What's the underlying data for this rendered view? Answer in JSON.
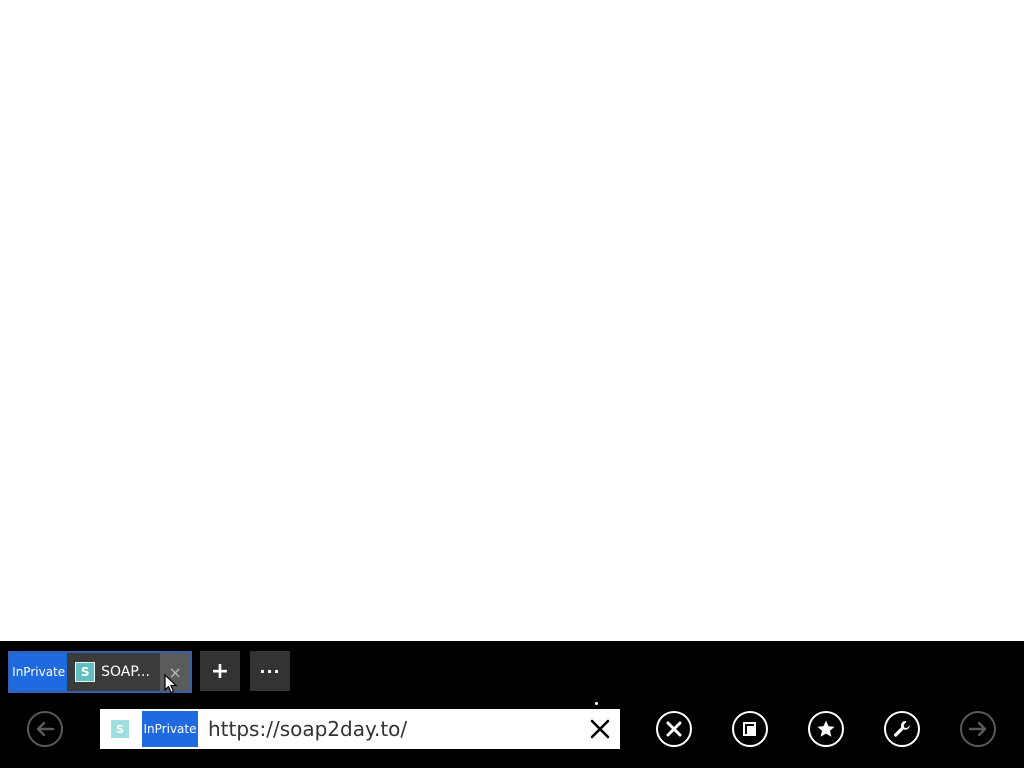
{
  "tab_strip": {
    "tabs": [
      {
        "inprivate_label": "InPrivate",
        "favicon": "S",
        "title": "SOAP...",
        "close_icon": "×"
      }
    ],
    "new_tab_label": "+",
    "tab_tools_label": "···"
  },
  "address_bar": {
    "favicon": "S",
    "inprivate_label": "InPrivate",
    "url": "https://soap2day.to/"
  },
  "nav": {
    "back_icon": "left-arrow-icon",
    "stop_icon": "stop-x-icon",
    "tabs_icon": "tabs-icon",
    "favorites_icon": "star-icon",
    "tools_icon": "wrench-icon",
    "forward_icon": "right-arrow-icon"
  },
  "colors": {
    "app_bar": "#000000",
    "inprivate_badge": "#1f6ae0",
    "favicon": "#5fbfc0"
  }
}
